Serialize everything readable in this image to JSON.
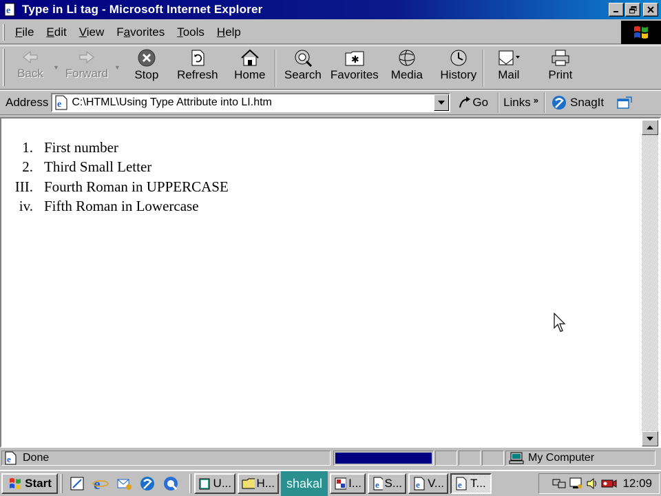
{
  "window": {
    "title": "Type in Li tag - Microsoft Internet Explorer",
    "controls": [
      "minimize",
      "maximize",
      "close"
    ]
  },
  "menu": {
    "items": [
      "File",
      "Edit",
      "View",
      "Favorites",
      "Tools",
      "Help"
    ],
    "accelerators": [
      "F",
      "E",
      "V",
      "a",
      "T",
      "H"
    ]
  },
  "toolbar": {
    "buttons": [
      {
        "label": "Back",
        "icon": "back-arrow-icon",
        "disabled": true
      },
      {
        "label": "Forward",
        "icon": "forward-arrow-icon",
        "disabled": true
      },
      {
        "label": "Stop",
        "icon": "stop-icon",
        "disabled": false
      },
      {
        "label": "Refresh",
        "icon": "refresh-icon",
        "disabled": false
      },
      {
        "label": "Home",
        "icon": "home-icon",
        "disabled": false
      },
      {
        "label": "Search",
        "icon": "search-icon",
        "disabled": false
      },
      {
        "label": "Favorites",
        "icon": "favorites-folder-icon",
        "disabled": false
      },
      {
        "label": "Media",
        "icon": "media-globe-icon",
        "disabled": false
      },
      {
        "label": "History",
        "icon": "history-icon",
        "disabled": false
      },
      {
        "label": "Mail",
        "icon": "mail-icon",
        "disabled": false
      },
      {
        "label": "Print",
        "icon": "printer-icon",
        "disabled": false
      }
    ]
  },
  "address": {
    "label": "Address",
    "value": "C:\\HTML\\Using Type Attribute into LI.htm",
    "go_label": "Go",
    "links_label": "Links",
    "snagit_label": "SnagIt"
  },
  "content": {
    "list_items": [
      {
        "marker": "1.",
        "text": "First number"
      },
      {
        "marker": "2.",
        "text": "Third Small Letter"
      },
      {
        "marker": "III.",
        "text": "Fourth Roman in UPPERCASE"
      },
      {
        "marker": "iv.",
        "text": "Fifth Roman in Lowercase"
      }
    ]
  },
  "status": {
    "text": "Done",
    "zone": "My Computer",
    "progress_fraction": 1.0
  },
  "taskbar": {
    "start_label": "Start",
    "tasks": [
      {
        "label": "U...",
        "icon": "book-icon",
        "active": false
      },
      {
        "label": "H...",
        "icon": "folder-icon",
        "active": false
      },
      {
        "label": "I...",
        "icon": "app-icon",
        "active": false
      },
      {
        "label": "S...",
        "icon": "ie-page-icon",
        "active": false
      },
      {
        "label": "V...",
        "icon": "ie-page-icon",
        "active": false
      },
      {
        "label": "T...",
        "icon": "ie-page-icon",
        "active": true
      }
    ],
    "overlay_text": "shakal",
    "clock": "12:09"
  },
  "colors": {
    "titlebar": "#000080",
    "face": "#c0c0c0",
    "progress": "#000080",
    "overlay": "#2a8f8f"
  }
}
